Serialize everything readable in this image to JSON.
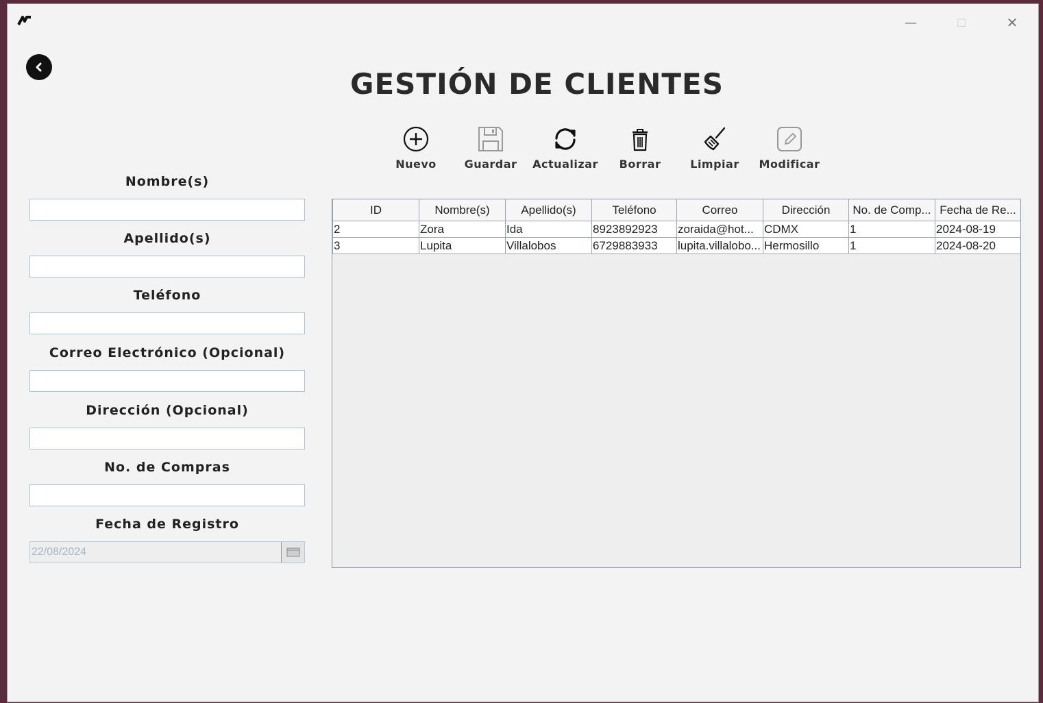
{
  "window": {
    "controls": {
      "minimize": "—",
      "maximize": "☐",
      "close": "✕"
    }
  },
  "icons": {
    "logo": "app-logo-icon",
    "back": "back-arrow-icon"
  },
  "header": {
    "title": "GESTIÓN DE CLIENTES"
  },
  "toolbar": [
    {
      "id": "nuevo",
      "label": "Nuevo",
      "icon": "plus-circle-icon",
      "enabled": true
    },
    {
      "id": "guardar",
      "label": "Guardar",
      "icon": "save-icon",
      "enabled": false
    },
    {
      "id": "actualizar",
      "label": "Actualizar",
      "icon": "refresh-icon",
      "enabled": true
    },
    {
      "id": "borrar",
      "label": "Borrar",
      "icon": "trash-icon",
      "enabled": true
    },
    {
      "id": "limpiar",
      "label": "Limpiar",
      "icon": "broom-icon",
      "enabled": true
    },
    {
      "id": "modificar",
      "label": "Modificar",
      "icon": "edit-icon",
      "enabled": false
    }
  ],
  "form": {
    "nombre_label": "Nombre(s)",
    "nombre_value": "",
    "apellido_label": "Apellido(s)",
    "apellido_value": "",
    "telefono_label": "Teléfono",
    "telefono_value": "",
    "correo_label": "Correo Electrónico (Opcional)",
    "correo_value": "",
    "direccion_label": "Dirección (Opcional)",
    "direccion_value": "",
    "compras_label": "No. de Compras",
    "compras_value": "",
    "fecha_label": "Fecha de Registro",
    "fecha_value": "22/08/2024"
  },
  "table": {
    "columns": [
      "ID",
      "Nombre(s)",
      "Apellido(s)",
      "Teléfono",
      "Correo",
      "Dirección",
      "No. de Comp...",
      "Fecha de Re..."
    ],
    "rows": [
      [
        "2",
        "Zora",
        "Ida",
        "8923892923",
        "zoraida@hot...",
        "CDMX",
        "1",
        "2024-08-19"
      ],
      [
        "3",
        "Lupita",
        "Villalobos",
        "6729883933",
        "lupita.villalobo...",
        "Hermosillo",
        "1",
        "2024-08-20"
      ]
    ]
  }
}
